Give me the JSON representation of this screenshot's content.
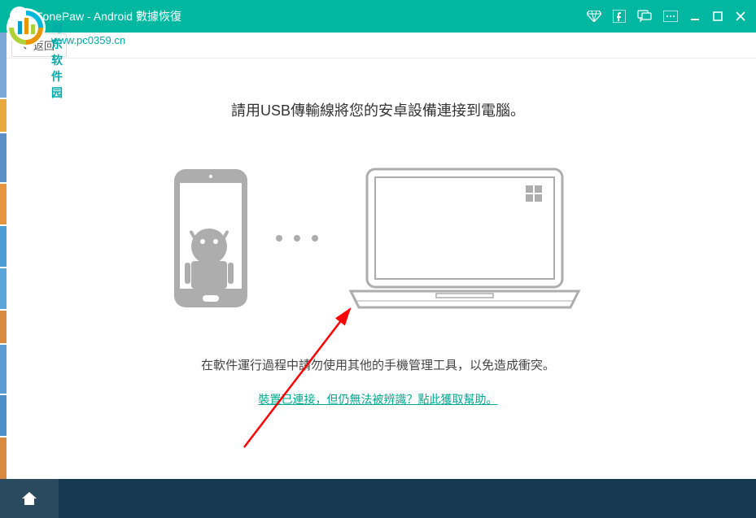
{
  "titlebar": {
    "title": "FonePaw - Android 數據恢復"
  },
  "back": {
    "label": "返回"
  },
  "watermark": {
    "text": "河东软件园",
    "url": "www.pc0359.cn"
  },
  "main": {
    "instruction": "請用USB傳輸線將您的安卓設備連接到電腦。",
    "warning": "在軟件運行過程中請勿使用其他的手機管理工具，以免造成衝突。",
    "help_link": "裝置已連接，但仍無法被辨識？點此獲取幫助。"
  }
}
